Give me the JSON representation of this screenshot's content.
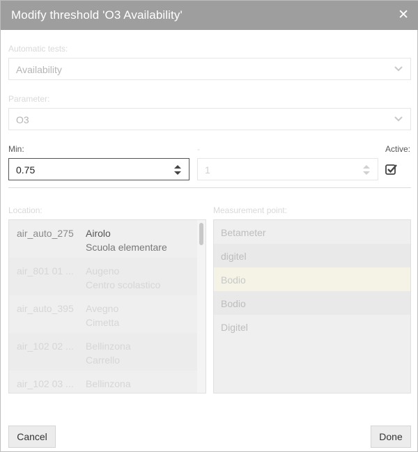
{
  "dialog": {
    "title": "Modify threshold 'O3 Availability'",
    "close_symbol": "✕"
  },
  "tests": {
    "label": "Automatic tests:",
    "value": "Availability"
  },
  "parameter": {
    "label": "Parameter:",
    "value": "O3"
  },
  "min": {
    "label": "Min:",
    "value": "0.75"
  },
  "max": {
    "label": "-",
    "value": "1"
  },
  "active": {
    "label": "Active:",
    "checked": true
  },
  "location": {
    "label": "Location:",
    "items": [
      {
        "id": "air_auto_275",
        "name": "Airolo",
        "sub": "Scuola elementare"
      },
      {
        "id": "air_801 01 ...",
        "name": "Augeno",
        "sub": "Centro scolastico"
      },
      {
        "id": "air_auto_395",
        "name": "Avegno",
        "sub": "Cimetta"
      },
      {
        "id": "air_102 02 ...",
        "name": "Bellinzona",
        "sub": "Carrello"
      },
      {
        "id": "air_102 03 ...",
        "name": "Bellinzona",
        "sub": ""
      }
    ]
  },
  "measurement": {
    "label": "Measurement point:",
    "items": [
      "Betameter",
      "digitel",
      "Bodio",
      "Bodio",
      "Digitel"
    ]
  },
  "footer": {
    "cancel": "Cancel",
    "done": "Done"
  }
}
